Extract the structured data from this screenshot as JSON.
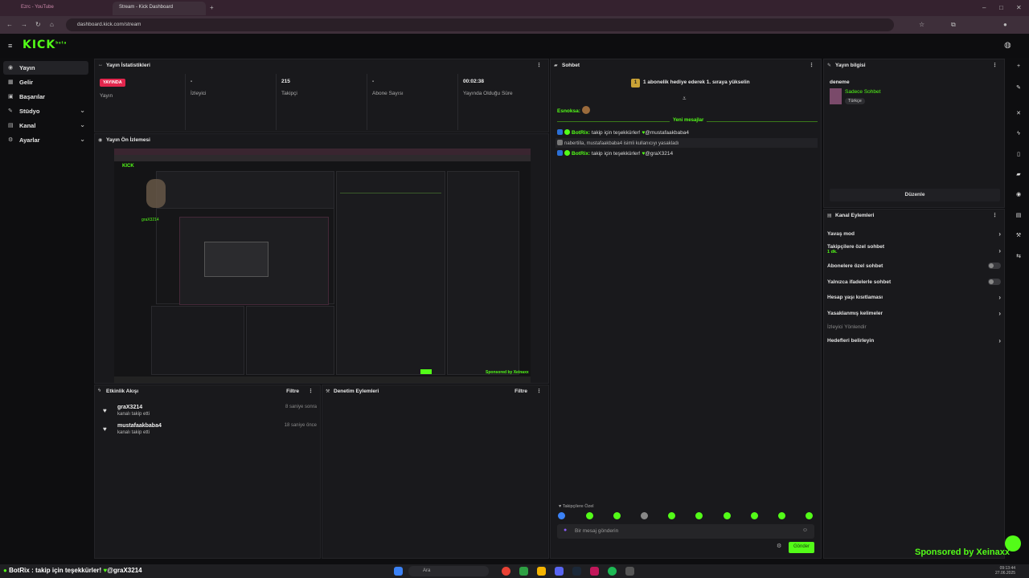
{
  "browser": {
    "tabs": [
      {
        "label": "Ezrc - YouTube"
      },
      {
        "label": "Stream - Kick Dashboard"
      }
    ],
    "url": "dashboard.kick.com/stream"
  },
  "app": {
    "logo": "KICK",
    "logo_sup": "beta"
  },
  "sidebar": {
    "items": [
      {
        "label": "Yayın",
        "icon": "broadcast-icon"
      },
      {
        "label": "Gelir",
        "icon": "money-icon"
      },
      {
        "label": "Başarılar",
        "icon": "trophy-icon"
      },
      {
        "label": "Stüdyo",
        "icon": "studio-icon"
      },
      {
        "label": "Kanal",
        "icon": "channel-icon"
      },
      {
        "label": "Ayarlar",
        "icon": "settings-icon"
      }
    ]
  },
  "stats": {
    "title": "Yayın İstatistikleri",
    "live_label": "YAYINDA",
    "items": [
      {
        "value": "",
        "label": "Yayın"
      },
      {
        "value": "-",
        "label": "İzleyici"
      },
      {
        "value": "215",
        "label": "Takipçi"
      },
      {
        "value": "-",
        "label": "Abone Sayısı"
      },
      {
        "value": "00:02:38",
        "label": "Yayında Olduğu Süre"
      }
    ]
  },
  "preview": {
    "title": "Yayın Ön İzlemesi",
    "watermark": "Sponsored by Xeinaxx",
    "overlay_user": "graX3214"
  },
  "activity": {
    "title": "Etkinlik Akışı",
    "filter": "Filtre",
    "items": [
      {
        "name": "graX3214",
        "desc": "kanalı takip etti",
        "time": "8 saniye sonra"
      },
      {
        "name": "mustafaakbaba4",
        "desc": "kanalı takip etti",
        "time": "18 saniye önce"
      }
    ]
  },
  "moderation": {
    "title": "Denetim Eylemleri",
    "filter": "Filtre"
  },
  "chat": {
    "title": "Sohbet",
    "gift_banner": "1 abonelik hediye ederek 1. sıraya yükselin",
    "gift_rank": "1",
    "emote_label": "Esnoksa:",
    "new_messages": "Yeni mesajlar",
    "messages": [
      {
        "user": "BotRix:",
        "text": "takip için teşekkürler!",
        "mention": "@mustafaakbaba4"
      },
      {
        "user": "",
        "text": "nabertilla, mustafaakbaba4 isimli kullanıcıyı yasakladı",
        "mention": ""
      },
      {
        "user": "BotRix:",
        "text": "takip için teşekkürler!",
        "mention": "@graX3214"
      }
    ],
    "followers_only": "Takipçilere Özel",
    "input_placeholder": "Bir mesaj gönderin",
    "send_label": "Gönder"
  },
  "stream_info": {
    "title": "Yayın bilgisi",
    "stream_title": "deneme",
    "category": "Sadece Sohbet",
    "language_tag": "Türkçe",
    "edit_label": "Düzenle"
  },
  "channel_actions": {
    "title": "Kanal Eylemleri",
    "rows": [
      {
        "label": "Yavaş mod",
        "control": "chevron"
      },
      {
        "label": "Takipçilere özel sohbet",
        "sub": "1 dk.",
        "control": "chevron"
      },
      {
        "label": "Abonelere özel sohbet",
        "control": "toggle"
      },
      {
        "label": "Yalnızca ifadelerle sohbet",
        "control": "toggle"
      },
      {
        "label": "Hesap yaşı kısıtlaması",
        "control": "chevron"
      },
      {
        "label": "Yasaklanmış kelimeler",
        "control": "chevron"
      },
      {
        "label": "İzleyici Yönlendir",
        "control": "none"
      },
      {
        "label": "Hedefleri belirleyin",
        "control": "chevron"
      }
    ]
  },
  "overlay": {
    "ticker": "BotRix : takip için teşekkürler!",
    "ticker_mention": "@graX3214",
    "sponsor": "Sponsored by Xeinaxx"
  },
  "taskbar": {
    "search": "Ara",
    "time": "09:13:44",
    "date": "27.06.2025"
  },
  "colors": {
    "accent": "#53fc18",
    "live": "#e2264d",
    "bg": "#0e0e10",
    "panel": "#19191c"
  }
}
